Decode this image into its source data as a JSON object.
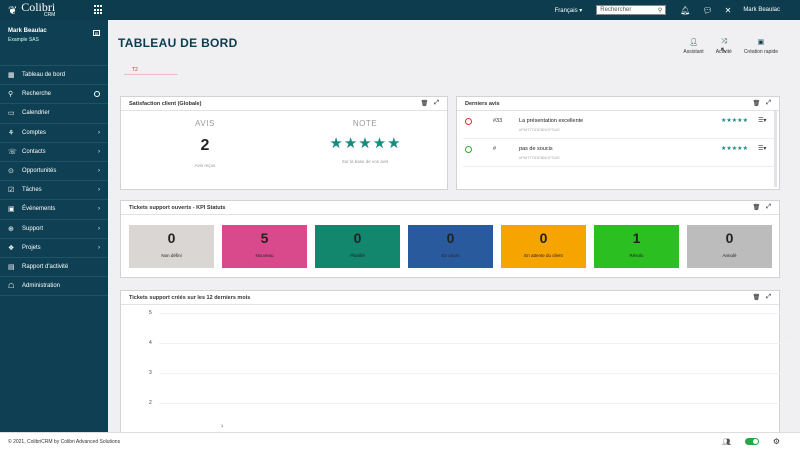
{
  "app": {
    "name": "Colibri",
    "sub": "CRM"
  },
  "topbar": {
    "language": "Français",
    "search_placeholder": "Rechercher",
    "user": "Mark Beaulac"
  },
  "sidebar": {
    "user_name": "Mark Beaulac",
    "user_org": "Example SAS",
    "items": [
      {
        "label": "Tableau de bord",
        "icon": "grid-icon"
      },
      {
        "label": "Recherche",
        "icon": "search-icon"
      },
      {
        "label": "Calendrier",
        "icon": "calendar-icon"
      },
      {
        "label": "Comptes",
        "icon": "accounts-icon"
      },
      {
        "label": "Contacts",
        "icon": "contacts-icon"
      },
      {
        "label": "Opportunités",
        "icon": "opportunities-icon"
      },
      {
        "label": "Tâches",
        "icon": "tasks-icon"
      },
      {
        "label": "Événements",
        "icon": "events-icon"
      },
      {
        "label": "Support",
        "icon": "support-icon"
      },
      {
        "label": "Projets",
        "icon": "projects-icon"
      },
      {
        "label": "Rapport d'activité",
        "icon": "report-icon"
      },
      {
        "label": "Administration",
        "icon": "admin-icon"
      }
    ]
  },
  "main": {
    "title": "TABLEAU DE BORD",
    "tab": "T2",
    "actions": [
      {
        "label": "Assistant",
        "icon": "assistant-icon"
      },
      {
        "label": "Activité",
        "icon": "activity-icon"
      },
      {
        "label": "Création rapide",
        "icon": "quick-create-icon"
      }
    ]
  },
  "satisfaction": {
    "title": "Satisfaction client (Globale)",
    "avis_label": "AVIS",
    "avis_value": "2",
    "avis_sub": "Avis reçus",
    "note_label": "NOTE",
    "note_stars": 5,
    "note_sub": "Sur la base de vos avis"
  },
  "reviews": {
    "title": "Derniers avis",
    "items": [
      {
        "flag_color": "#d33",
        "id": "#33",
        "title": "La présentation excellente",
        "sub": "#PMTTODEBNGFSAS",
        "stars": 5
      },
      {
        "flag_color": "#3a3",
        "id": "#",
        "title": "pas de soucis",
        "sub": "#PMTTODEBNGFSAS",
        "stars": 5
      }
    ]
  },
  "tickets": {
    "title": "Tickets support ouverts - KPI Statuts",
    "items": [
      {
        "value": "0",
        "label": "Non défini",
        "color": "#d9d6d4"
      },
      {
        "value": "5",
        "label": "Nouveau",
        "color": "#d94a8c"
      },
      {
        "value": "0",
        "label": "Planifié",
        "color": "#12876e"
      },
      {
        "value": "0",
        "label": "En cours",
        "color": "#2a5a9e"
      },
      {
        "value": "0",
        "label": "En attente du client",
        "color": "#f6a400"
      },
      {
        "value": "1",
        "label": "Résolu",
        "color": "#2bbf22"
      },
      {
        "value": "0",
        "label": "Annulé",
        "color": "#bcbcbc"
      }
    ]
  },
  "chart": {
    "title": "Tickets support créés sur les 12 derniers mois"
  },
  "chart_data": {
    "type": "bar",
    "title": "Tickets support créés sur les 12 derniers mois",
    "yticks": [
      "5",
      "4",
      "3",
      "2"
    ],
    "x_marker": "1",
    "ylim": [
      0,
      5
    ]
  },
  "footer": {
    "copyright": "© 2021, ColibriCRM by Colibri Advanced Solutions"
  }
}
